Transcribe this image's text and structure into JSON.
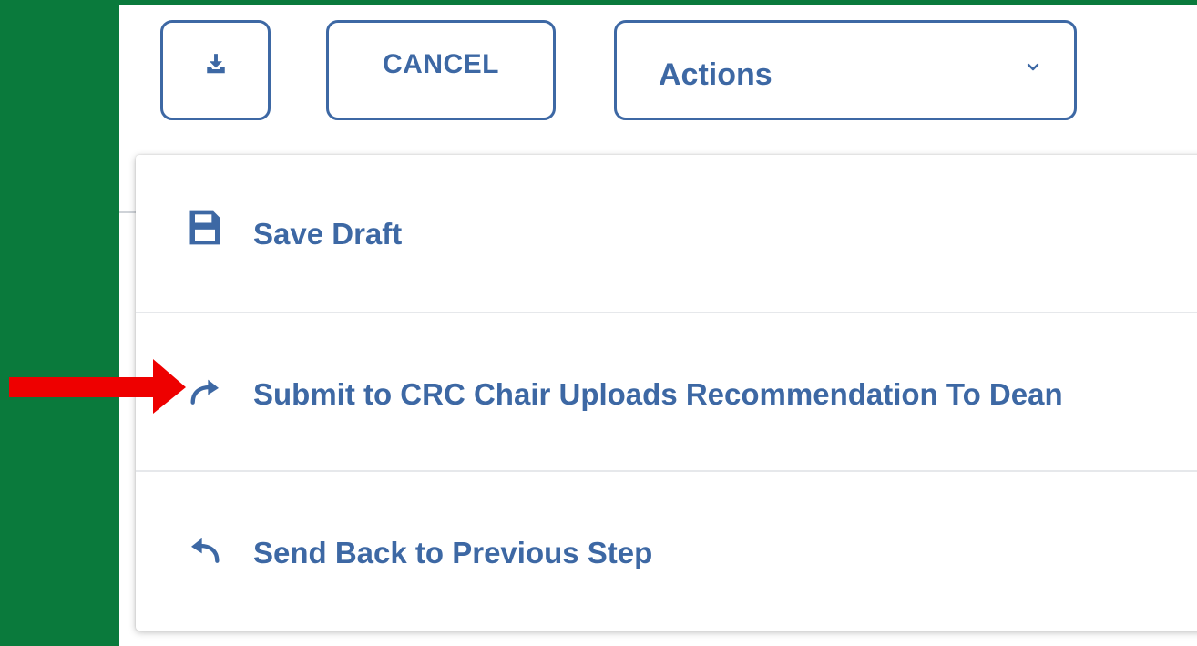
{
  "toolbar": {
    "download_icon": "download-icon",
    "cancel_label": "CANCEL",
    "actions_select": {
      "value": "Actions",
      "chevron_icon": "chevron-down-icon"
    }
  },
  "menu": {
    "items": [
      {
        "label": "Save Draft",
        "icon": "save-icon"
      },
      {
        "label": "Submit to CRC Chair Uploads Recommendation To Dean",
        "icon": "redo-icon"
      },
      {
        "label": "Send Back to Previous Step",
        "icon": "undo-icon"
      }
    ]
  },
  "annotation": {
    "arrow_icon": "red-arrow-icon",
    "arrow_color": "#ee0000"
  },
  "colors": {
    "accent": "#3d68a4",
    "background_green": "#0a7a3c",
    "panel": "#ffffff"
  }
}
